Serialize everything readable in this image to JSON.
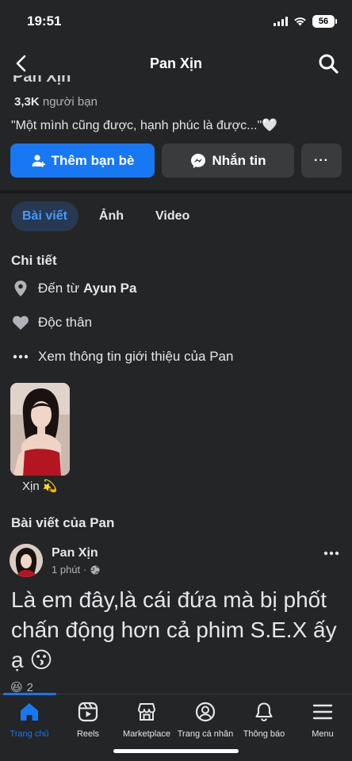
{
  "status_bar": {
    "time": "19:51",
    "battery": "56"
  },
  "header": {
    "title": "Pan Xịn"
  },
  "profile": {
    "friends_count": "3,3K",
    "friends_label": "người bạn",
    "bio": "\"Một mình cũng được, hạnh phúc là được...\"🤍",
    "add_friend_label": "Thêm bạn bè",
    "message_label": "Nhắn tin",
    "more_label": "···"
  },
  "tabs": [
    {
      "label": "Bài viết",
      "active": true
    },
    {
      "label": "Ảnh",
      "active": false
    },
    {
      "label": "Video",
      "active": false
    }
  ],
  "details": {
    "title": "Chi tiết",
    "from_prefix": "Đến từ",
    "from_place": "Ayun Pa",
    "relationship": "Độc thân",
    "see_intro": "Xem thông tin giới thiệu của Pan"
  },
  "featured": {
    "label": "Xịn 💫"
  },
  "posts_section": {
    "title": "Bài viết của Pan"
  },
  "post": {
    "author": "Pan Xịn",
    "time": "1 phút",
    "text": "Là em đây,là cái đứa mà bị phốt chấn động hơn cả phim S.E.X ấy ạ 😗",
    "reaction_emoji": "😆",
    "reaction_count": "2"
  },
  "bottom_nav": [
    {
      "label": "Trang chủ",
      "icon": "home-icon",
      "active": true
    },
    {
      "label": "Reels",
      "icon": "reels-icon",
      "active": false
    },
    {
      "label": "Marketplace",
      "icon": "marketplace-icon",
      "active": false
    },
    {
      "label": "Trang cá nhân",
      "icon": "profile-icon",
      "active": false
    },
    {
      "label": "Thông báo",
      "icon": "bell-icon",
      "active": false
    },
    {
      "label": "Menu",
      "icon": "menu-icon",
      "active": false
    }
  ]
}
